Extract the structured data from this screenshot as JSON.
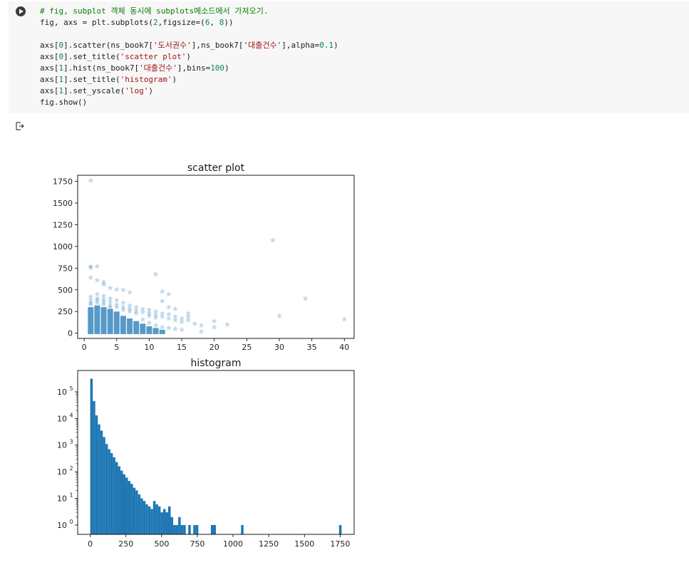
{
  "cell": {
    "code_lines": [
      [
        {
          "t": "# fig, subplot 객체 동시에 subplots메소드에서 가져오기.",
          "c": "comment"
        }
      ],
      [
        {
          "t": "fig, axs = plt.subplots(",
          "c": ""
        },
        {
          "t": "2",
          "c": "num"
        },
        {
          "t": ",figsize=(",
          "c": ""
        },
        {
          "t": "6",
          "c": "num"
        },
        {
          "t": ", ",
          "c": ""
        },
        {
          "t": "8",
          "c": "num"
        },
        {
          "t": "))",
          "c": ""
        }
      ],
      [],
      [
        {
          "t": "axs[",
          "c": ""
        },
        {
          "t": "0",
          "c": "num"
        },
        {
          "t": "].scatter(ns_book7[",
          "c": ""
        },
        {
          "t": "'도서권수'",
          "c": "str"
        },
        {
          "t": "],ns_book7[",
          "c": ""
        },
        {
          "t": "'대출건수'",
          "c": "str"
        },
        {
          "t": "],alpha=",
          "c": ""
        },
        {
          "t": "0.1",
          "c": "num"
        },
        {
          "t": ")",
          "c": ""
        }
      ],
      [
        {
          "t": "axs[",
          "c": ""
        },
        {
          "t": "0",
          "c": "num"
        },
        {
          "t": "].set_title(",
          "c": ""
        },
        {
          "t": "'scatter plot'",
          "c": "str"
        },
        {
          "t": ")",
          "c": ""
        }
      ],
      [
        {
          "t": "axs[",
          "c": ""
        },
        {
          "t": "1",
          "c": "num"
        },
        {
          "t": "].hist(ns_book7[",
          "c": ""
        },
        {
          "t": "'대출건수'",
          "c": "str"
        },
        {
          "t": "],bins=",
          "c": ""
        },
        {
          "t": "100",
          "c": "num"
        },
        {
          "t": ")",
          "c": ""
        }
      ],
      [
        {
          "t": "axs[",
          "c": ""
        },
        {
          "t": "1",
          "c": "num"
        },
        {
          "t": "].set_title(",
          "c": ""
        },
        {
          "t": "'histogram'",
          "c": "str"
        },
        {
          "t": ")",
          "c": ""
        }
      ],
      [
        {
          "t": "axs[",
          "c": ""
        },
        {
          "t": "1",
          "c": "num"
        },
        {
          "t": "].set_yscale(",
          "c": ""
        },
        {
          "t": "'log'",
          "c": "str"
        },
        {
          "t": ")",
          "c": ""
        }
      ],
      [
        {
          "t": "fig.show()",
          "c": ""
        }
      ]
    ],
    "run_icon": "play-circle-icon",
    "output_icon": "output-arrow-icon"
  },
  "colors": {
    "accent": "#1f77b4",
    "cell_bg": "#f7f7f7",
    "comment": "#0a7d00",
    "string": "#a31515",
    "number": "#098658"
  },
  "chart_data": [
    {
      "type": "scatter",
      "title": "scatter plot",
      "marker": "star",
      "alpha": 0.1,
      "xlim": [
        -1,
        41.5
      ],
      "ylim": [
        -60,
        1820
      ],
      "xticks": [
        0,
        5,
        10,
        15,
        20,
        25,
        30,
        35,
        40
      ],
      "yticks": [
        0,
        250,
        500,
        750,
        1000,
        1250,
        1500,
        1750
      ],
      "points": [
        [
          1,
          1760
        ],
        [
          1,
          770
        ],
        [
          1,
          755
        ],
        [
          2,
          770
        ],
        [
          1,
          640
        ],
        [
          2,
          610
        ],
        [
          3,
          590
        ],
        [
          3,
          560
        ],
        [
          4,
          520
        ],
        [
          5,
          505
        ],
        [
          6,
          500
        ],
        [
          7,
          470
        ],
        [
          11,
          680
        ],
        [
          12,
          480
        ],
        [
          13,
          450
        ],
        [
          12,
          370
        ],
        [
          13,
          300
        ],
        [
          14,
          280
        ],
        [
          16,
          230
        ],
        [
          16,
          190
        ],
        [
          20,
          140
        ],
        [
          22,
          100
        ],
        [
          20,
          70
        ],
        [
          18,
          20
        ],
        [
          29,
          1070
        ],
        [
          30,
          200
        ],
        [
          34,
          400
        ],
        [
          40,
          160
        ],
        [
          1,
          420
        ],
        [
          1,
          380
        ],
        [
          1,
          350
        ],
        [
          1,
          330
        ],
        [
          2,
          450
        ],
        [
          2,
          400
        ],
        [
          2,
          380
        ],
        [
          2,
          350
        ],
        [
          3,
          430
        ],
        [
          3,
          390
        ],
        [
          3,
          360
        ],
        [
          3,
          330
        ],
        [
          4,
          400
        ],
        [
          4,
          360
        ],
        [
          4,
          320
        ],
        [
          4,
          300
        ],
        [
          5,
          380
        ],
        [
          5,
          330
        ],
        [
          5,
          300
        ],
        [
          6,
          350
        ],
        [
          6,
          300
        ],
        [
          6,
          270
        ],
        [
          7,
          320
        ],
        [
          7,
          280
        ],
        [
          7,
          250
        ],
        [
          8,
          300
        ],
        [
          8,
          260
        ],
        [
          8,
          230
        ],
        [
          9,
          280
        ],
        [
          9,
          240
        ],
        [
          10,
          270
        ],
        [
          10,
          230
        ],
        [
          10,
          200
        ],
        [
          11,
          250
        ],
        [
          11,
          210
        ],
        [
          11,
          180
        ],
        [
          12,
          230
        ],
        [
          12,
          190
        ],
        [
          13,
          220
        ],
        [
          13,
          170
        ],
        [
          14,
          190
        ],
        [
          14,
          150
        ],
        [
          15,
          170
        ],
        [
          15,
          130
        ],
        [
          16,
          150
        ],
        [
          17,
          110
        ],
        [
          18,
          90
        ],
        [
          9,
          160
        ],
        [
          10,
          120
        ],
        [
          11,
          90
        ],
        [
          12,
          70
        ],
        [
          13,
          60
        ],
        [
          14,
          50
        ],
        [
          15,
          40
        ]
      ],
      "bands": [
        {
          "x": 1,
          "top": 300
        },
        {
          "x": 2,
          "top": 320
        },
        {
          "x": 3,
          "top": 300
        },
        {
          "x": 4,
          "top": 280
        },
        {
          "x": 5,
          "top": 250
        },
        {
          "x": 6,
          "top": 200
        },
        {
          "x": 7,
          "top": 170
        },
        {
          "x": 8,
          "top": 140
        },
        {
          "x": 9,
          "top": 110
        },
        {
          "x": 10,
          "top": 80
        },
        {
          "x": 11,
          "top": 60
        },
        {
          "x": 12,
          "top": 40
        }
      ]
    },
    {
      "type": "bar",
      "title": "histogram",
      "yscale": "log",
      "bins": 100,
      "xlim": [
        -88,
        1848
      ],
      "ylim_log": [
        -0.35,
        5.8
      ],
      "xticks": [
        0,
        250,
        500,
        750,
        1000,
        1250,
        1500,
        1750
      ],
      "yticks": [
        0,
        1,
        2,
        3,
        4,
        5
      ],
      "bin_width": 17.6,
      "counts": [
        310000,
        45000,
        13000,
        6000,
        3500,
        2000,
        1100,
        700,
        500,
        350,
        230,
        160,
        110,
        80,
        60,
        45,
        35,
        25,
        20,
        14,
        10,
        8,
        6,
        5,
        4,
        8,
        6,
        5,
        3,
        4,
        3,
        5,
        2,
        1,
        1,
        2,
        1,
        1,
        0,
        1,
        0,
        1,
        1,
        0,
        0,
        0,
        0,
        0,
        1,
        1,
        0,
        0,
        0,
        0,
        0,
        0,
        0,
        0,
        0,
        0,
        1,
        0,
        0,
        0,
        0,
        0,
        0,
        0,
        0,
        0,
        0,
        0,
        0,
        0,
        0,
        0,
        0,
        0,
        0,
        0,
        0,
        0,
        0,
        0,
        0,
        0,
        0,
        0,
        0,
        0,
        0,
        0,
        0,
        0,
        0,
        0,
        0,
        0,
        0,
        1
      ]
    }
  ]
}
